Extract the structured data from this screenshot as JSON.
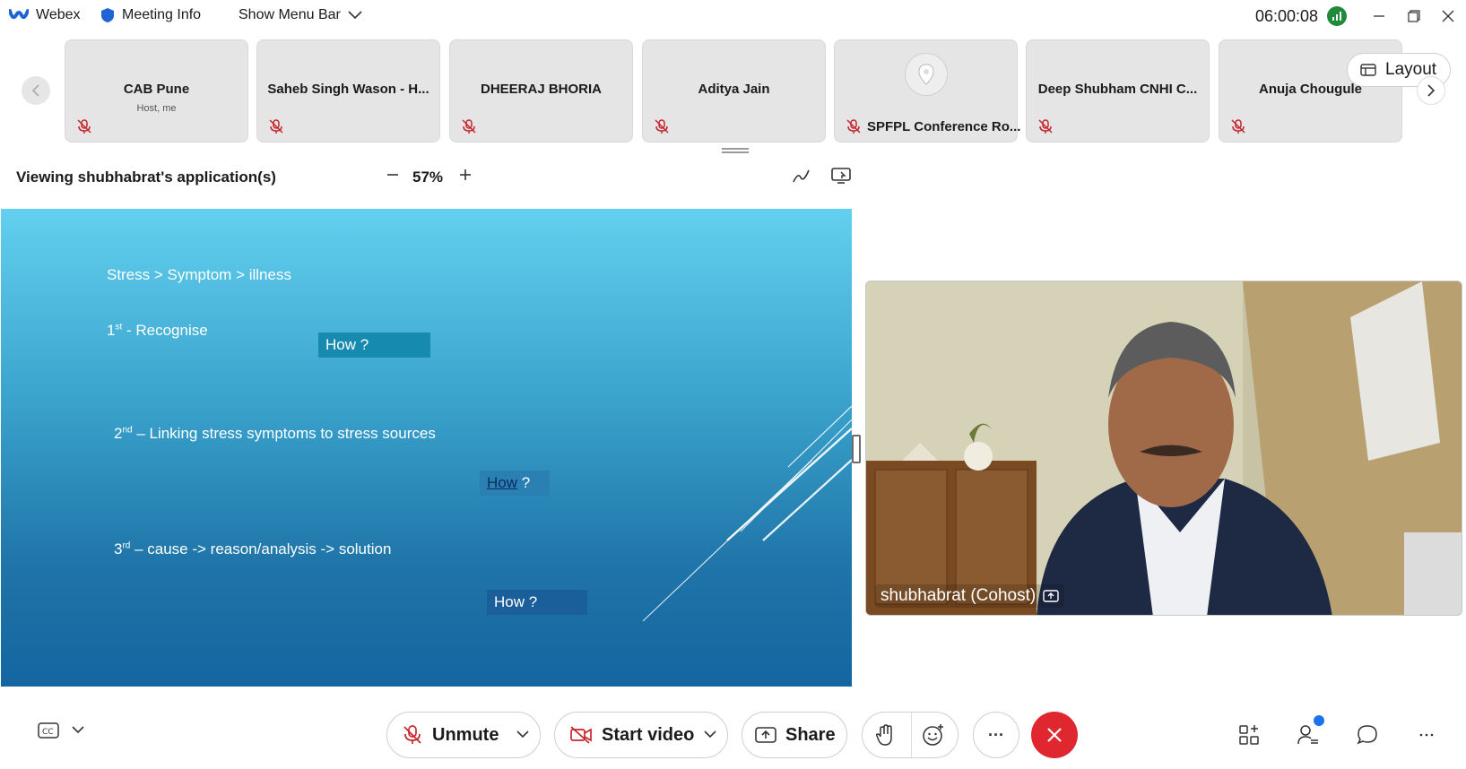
{
  "titlebar": {
    "app_name": "Webex",
    "meeting_info": "Meeting Info",
    "menu_bar": "Show Menu Bar",
    "clock": "06:00:08"
  },
  "participants": [
    {
      "name": "CAB Pune",
      "sub": "Host, me"
    },
    {
      "name": "Saheb Singh Wason - H..."
    },
    {
      "name": "DHEERAJ BHORIA"
    },
    {
      "name": "Aditya Jain"
    },
    {
      "name": "SPFPL Conference Ro..."
    },
    {
      "name": "Deep Shubham CNHI C..."
    },
    {
      "name": "Anuja Chougule"
    }
  ],
  "layout_label": "Layout",
  "sharebar": {
    "title": "Viewing shubhabrat's application(s)",
    "zoom": "57%"
  },
  "slide": {
    "line1": "Stress > Symptom > illness",
    "line2_sup": "st",
    "line2_num": "1",
    "line2_text": " - Recognise",
    "how1": "How ?",
    "line3_num": "2",
    "line3_sup": "nd",
    "line3_text": " – Linking stress symptoms to stress sources",
    "how2_link": "How",
    "how2_rest": " ?",
    "line4_num": "3",
    "line4_sup": "rd",
    "line4_text": " –   cause ->   reason/analysis ->     solution",
    "how3": "How ?"
  },
  "video": {
    "label": "shubhabrat (Cohost)"
  },
  "controls": {
    "unmute": "Unmute",
    "start_video": "Start video",
    "share": "Share",
    "more": "···"
  },
  "colors": {
    "end_call": "#e0262e",
    "signal": "#1f8a3a",
    "notification": "#1a73e8"
  }
}
